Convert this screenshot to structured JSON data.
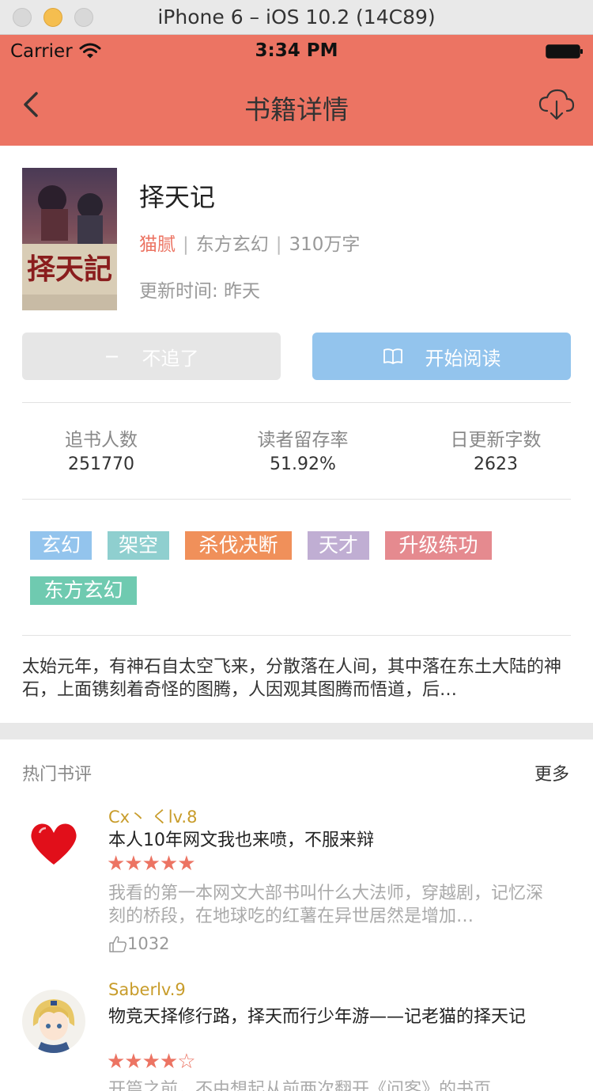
{
  "window": {
    "title": "iPhone 6 – iOS 10.2 (14C89)"
  },
  "status_bar": {
    "carrier": "Carrier",
    "time": "3:34 PM"
  },
  "nav": {
    "title": "书籍详情"
  },
  "colors": {
    "header": "#ec7463",
    "accent": "#ec7463",
    "read_button": "#93c4ed",
    "username": "#c89c2a"
  },
  "book": {
    "title": "择天记",
    "author": "猫腻",
    "category": "东方玄幻",
    "word_count": "310万字",
    "update": "更新时间: 昨天",
    "cover_text": "择天記"
  },
  "actions": {
    "unfollow_icon": "−",
    "unfollow": "不追了",
    "read": "开始阅读",
    "read_icon": "book-icon"
  },
  "stats": [
    {
      "label": "追书人数",
      "value": "251770"
    },
    {
      "label": "读者留存率",
      "value": "51.92%"
    },
    {
      "label": "日更新字数",
      "value": "2623"
    }
  ],
  "tags": [
    {
      "label": "玄幻",
      "color": "#93c4ed"
    },
    {
      "label": "架空",
      "color": "#8fcfcf"
    },
    {
      "label": "杀伐决断",
      "color": "#f0905a"
    },
    {
      "label": "天才",
      "color": "#c0aed3"
    },
    {
      "label": "升级练功",
      "color": "#e58a8f"
    },
    {
      "label": "东方玄幻",
      "color": "#6fcab0"
    }
  ],
  "intro": "太始元年，有神石自太空飞来，分散落在人间，其中落在东土大陆的神石，上面镌刻着奇怪的图腾，人因观其图腾而悟道，后…",
  "reviews_section": {
    "title": "热门书评",
    "more": "更多"
  },
  "reviews": [
    {
      "user": "Cx丶 くlv.8",
      "title": "本人10年网文我也来喷，不服来辩",
      "stars": "★★★★★",
      "rating": 5,
      "body": "我看的第一本网文大部书叫什么大法师，穿越剧，记忆深刻的桥段，在地球吃的红薯在异世居然是增加…",
      "likes": "1032"
    },
    {
      "user": "Saberlv.9",
      "title": "物竞天择修行路，择天而行少年游——记老猫的择天记",
      "stars": "★★★★☆",
      "rating": 4,
      "body": "开篇之前，不由想起从前两次翻开《问客》的书页"
    }
  ]
}
